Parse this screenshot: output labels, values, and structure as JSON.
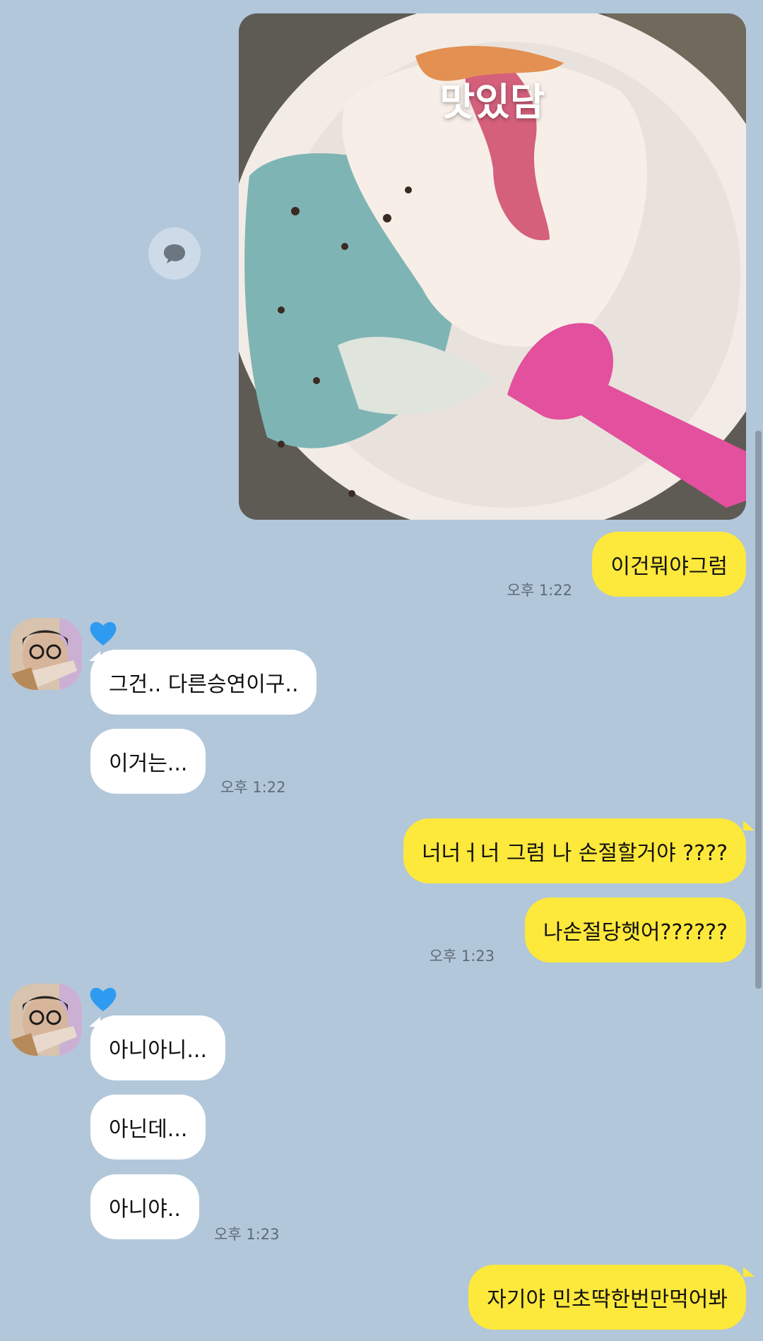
{
  "photo": {
    "caption": "맛있담",
    "image_description_icon": "ice-cream-cup-photo"
  },
  "reply_button": {
    "icon": "speech-bubble-icon"
  },
  "messages": {
    "m1": {
      "text": "이건뭐야그럼",
      "time": "오후 1:22"
    },
    "g1": {
      "line1": "그건.. 다른승연이구..",
      "line2": "이거는...",
      "time": "오후 1:22",
      "badge_icon": "blue-heart-icon"
    },
    "m2": {
      "line1": "너너ㅓ너 그럼 나 손절할거야 ????",
      "line2": "나손절당햇어??????",
      "time": "오후 1:23"
    },
    "g2": {
      "line1": "아니아니...",
      "line2": "아닌데...",
      "line3": "아니야..",
      "time": "오후 1:23",
      "badge_icon": "blue-heart-icon"
    },
    "m3": {
      "text": "자기야 민초딱한번만먹어봐"
    }
  },
  "colors": {
    "background": "#b2c7da",
    "my_bubble": "#fde83c",
    "their_bubble": "#ffffff",
    "heart": "#2f9bf0"
  }
}
